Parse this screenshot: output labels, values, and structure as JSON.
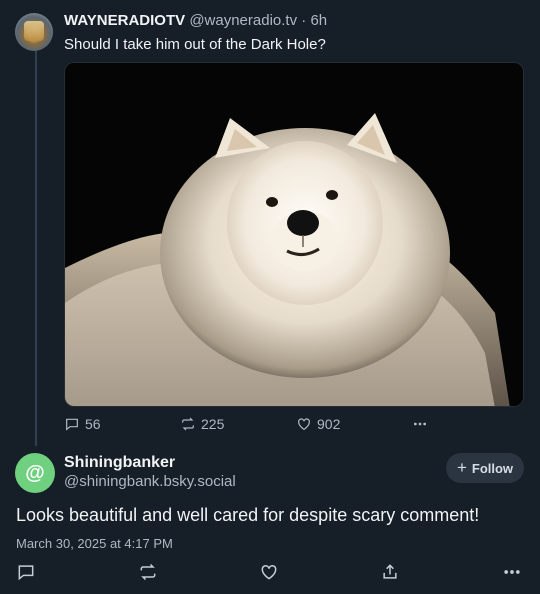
{
  "post": {
    "author_name": "WAYNERADIOTV",
    "author_handle": "@wayneradio.tv",
    "separator": "·",
    "age": "6h",
    "text": "Should I take him out of the Dark Hole?",
    "image_alt": "white fluffy dog against black background",
    "stats": {
      "replies": "56",
      "reposts": "225",
      "likes": "902"
    }
  },
  "reply": {
    "author_name": "Shiningbanker",
    "author_handle": "@shiningbank.bsky.social",
    "avatar_symbol": "@",
    "avatar_color": "#6fd07f",
    "follow_label": "Follow",
    "text": "Looks beautiful and well cared for despite scary comment!",
    "timestamp": "March 30, 2025 at 4:17 PM"
  },
  "icons": [
    "reply-icon",
    "repost-icon",
    "like-icon",
    "more-icon",
    "share-icon",
    "plus-icon"
  ],
  "colors": {
    "background": "#161e27",
    "muted": "#aeb9c5",
    "follow_bg": "#2a3541"
  }
}
